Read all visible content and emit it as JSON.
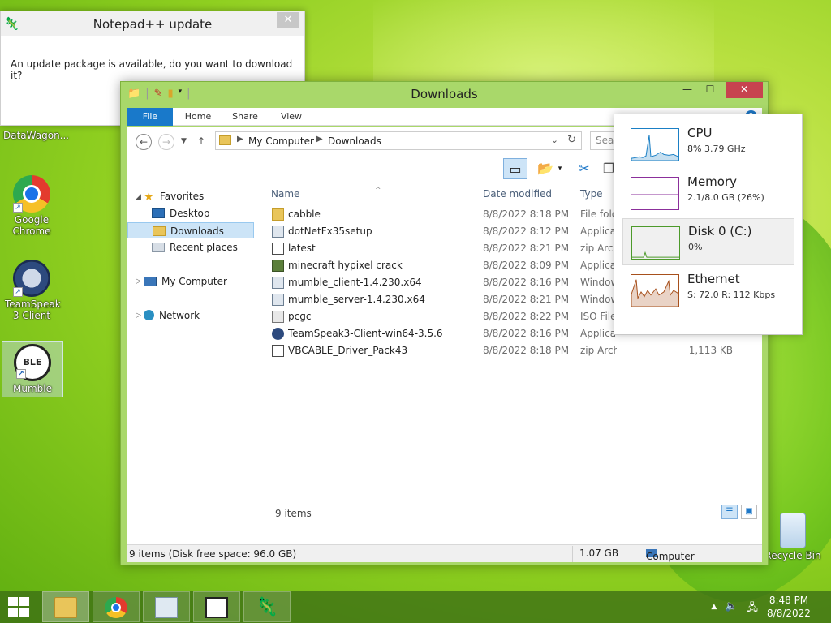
{
  "notepad_update": {
    "title": "Notepad++ update",
    "message": "An update package is available, do you want to download it?",
    "close": "✕"
  },
  "desktop": {
    "icons": [
      {
        "label": "DataWagon..."
      },
      {
        "label": "Google Chrome"
      },
      {
        "label": "TeamSpeak 3 Client"
      },
      {
        "label": "Mumble"
      },
      {
        "label": "Recycle Bin"
      }
    ]
  },
  "explorer": {
    "title": "Downloads",
    "window_controls": {
      "minimize": "—",
      "maximize": "☐",
      "close": "✕"
    },
    "ribbon_tabs": [
      "File",
      "Home",
      "Share",
      "View"
    ],
    "help": "?",
    "address": {
      "crumbs": [
        "My Computer",
        "Downloads"
      ],
      "search_placeholder": "Sear"
    },
    "nav": {
      "favorites": "Favorites",
      "desktop": "Desktop",
      "downloads": "Downloads",
      "recent": "Recent places",
      "computer": "My Computer",
      "network": "Network"
    },
    "columns": {
      "name": "Name",
      "date": "Date modified",
      "type": "Type"
    },
    "files": [
      {
        "name": "cabble",
        "date": "8/8/2022 8:18 PM",
        "type": "File folder",
        "size": "",
        "icon": "folder"
      },
      {
        "name": "dotNetFx35setup",
        "date": "8/8/2022 8:12 PM",
        "type": "Application",
        "size": "",
        "icon": "installer"
      },
      {
        "name": "latest",
        "date": "8/8/2022 8:21 PM",
        "type": "zip Archive",
        "size": "",
        "icon": "zip"
      },
      {
        "name": "minecraft hypixel crack",
        "date": "8/8/2022 8:09 PM",
        "type": "Application",
        "size": "",
        "icon": "minecraft"
      },
      {
        "name": "mumble_client-1.4.230.x64",
        "date": "8/8/2022 8:16 PM",
        "type": "Windows Installer",
        "size": "",
        "icon": "installer"
      },
      {
        "name": "mumble_server-1.4.230.x64",
        "date": "8/8/2022 8:21 PM",
        "type": "Windows Installer",
        "size": "",
        "icon": "installer"
      },
      {
        "name": "pcgc",
        "date": "8/8/2022 8:22 PM",
        "type": "ISO File",
        "size": "",
        "icon": "iso"
      },
      {
        "name": "TeamSpeak3-Client-win64-3.5.6",
        "date": "8/8/2022 8:16 PM",
        "type": "Application",
        "size": "",
        "icon": "teamspeak"
      },
      {
        "name": "VBCABLE_Driver_Pack43",
        "date": "8/8/2022 8:18 PM",
        "type": "zip Archive",
        "size": "1,113 KB",
        "icon": "zip"
      }
    ],
    "item_count": "9 items",
    "status": {
      "left": "9 items (Disk free space: 96.0 GB)",
      "size": "1.07 GB",
      "location": "Computer"
    }
  },
  "performance": {
    "items": [
      {
        "name": "CPU",
        "value": "8% 3.79 GHz",
        "color": "#1a7fc5"
      },
      {
        "name": "Memory",
        "value": "2.1/8.0 GB (26%)",
        "color": "#8b2f9b"
      },
      {
        "name": "Disk 0 (C:)",
        "value": "0%",
        "color": "#4c9a2a"
      },
      {
        "name": "Ethernet",
        "value": "S: 72.0  R: 112 Kbps",
        "color": "#a7501c"
      }
    ]
  },
  "taskbar": {
    "apps": [
      "File Explorer",
      "Google Chrome",
      "Performance Monitor",
      "Mumble",
      "Notepad++"
    ],
    "time": "8:48 PM",
    "date": "8/8/2022"
  }
}
